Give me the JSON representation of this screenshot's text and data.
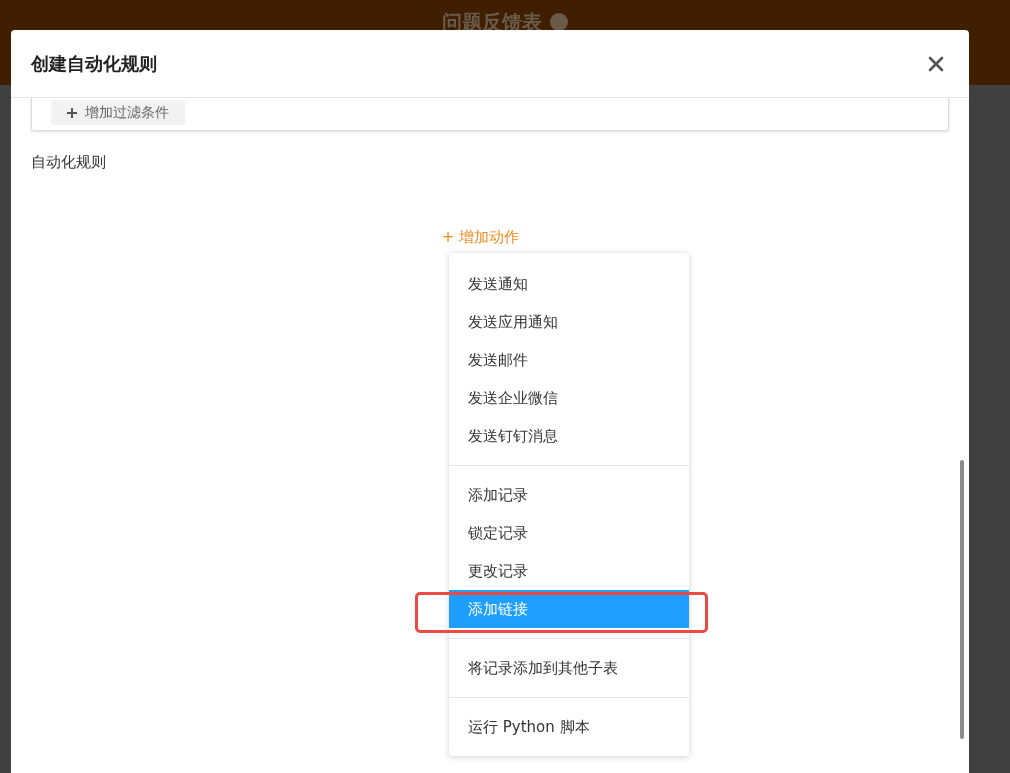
{
  "page": {
    "title": "问题反馈表"
  },
  "dialog": {
    "title": "创建自动化规则",
    "filter_button": "增加过滤条件",
    "section_label": "自动化规则",
    "add_action": "+ 增加动作",
    "menu": [
      {
        "items": [
          {
            "label": "发送通知",
            "selected": false,
            "annotated": false
          },
          {
            "label": "发送应用通知",
            "selected": false,
            "annotated": false
          },
          {
            "label": "发送邮件",
            "selected": false,
            "annotated": false
          },
          {
            "label": "发送企业微信",
            "selected": false,
            "annotated": false
          },
          {
            "label": "发送钉钉消息",
            "selected": false,
            "annotated": false
          }
        ]
      },
      {
        "items": [
          {
            "label": "添加记录",
            "selected": false,
            "annotated": false
          },
          {
            "label": "锁定记录",
            "selected": false,
            "annotated": false
          },
          {
            "label": "更改记录",
            "selected": false,
            "annotated": false
          },
          {
            "label": "添加链接",
            "selected": true,
            "annotated": true
          }
        ]
      },
      {
        "items": [
          {
            "label": "将记录添加到其他子表",
            "selected": false,
            "annotated": false
          }
        ]
      },
      {
        "items": [
          {
            "label": "运行 Python 脚本",
            "selected": false,
            "annotated": false
          }
        ]
      }
    ]
  }
}
